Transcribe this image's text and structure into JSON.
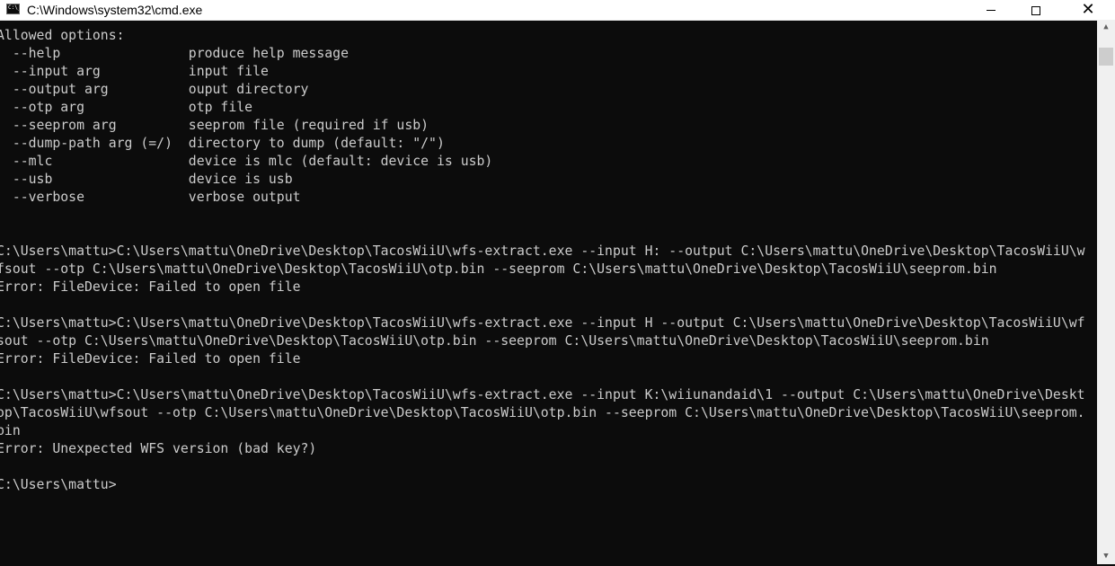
{
  "window": {
    "title": "C:\\Windows\\system32\\cmd.exe",
    "icon_text": "C:\\_",
    "controls": {
      "minimize": "minimize-icon",
      "maximize": "maximize-icon",
      "close": "✕"
    }
  },
  "console": {
    "lines": [
      "Allowed options:",
      "  --help                produce help message",
      "  --input arg           input file",
      "  --output arg          ouput directory",
      "  --otp arg             otp file",
      "  --seeprom arg         seeprom file (required if usb)",
      "  --dump-path arg (=/)  directory to dump (default: \"/\")",
      "  --mlc                 device is mlc (default: device is usb)",
      "  --usb                 device is usb",
      "  --verbose             verbose output",
      "",
      "",
      "C:\\Users\\mattu>C:\\Users\\mattu\\OneDrive\\Desktop\\TacosWiiU\\wfs-extract.exe --input H: --output C:\\Users\\mattu\\OneDrive\\Desktop\\TacosWiiU\\w",
      "fsout --otp C:\\Users\\mattu\\OneDrive\\Desktop\\TacosWiiU\\otp.bin --seeprom C:\\Users\\mattu\\OneDrive\\Desktop\\TacosWiiU\\seeprom.bin",
      "Error: FileDevice: Failed to open file",
      "",
      "C:\\Users\\mattu>C:\\Users\\mattu\\OneDrive\\Desktop\\TacosWiiU\\wfs-extract.exe --input H --output C:\\Users\\mattu\\OneDrive\\Desktop\\TacosWiiU\\wf",
      "sout --otp C:\\Users\\mattu\\OneDrive\\Desktop\\TacosWiiU\\otp.bin --seeprom C:\\Users\\mattu\\OneDrive\\Desktop\\TacosWiiU\\seeprom.bin",
      "Error: FileDevice: Failed to open file",
      "",
      "C:\\Users\\mattu>C:\\Users\\mattu\\OneDrive\\Desktop\\TacosWiiU\\wfs-extract.exe --input K:\\wiiunandaid\\1 --output C:\\Users\\mattu\\OneDrive\\Deskt",
      "op\\TacosWiiU\\wfsout --otp C:\\Users\\mattu\\OneDrive\\Desktop\\TacosWiiU\\otp.bin --seeprom C:\\Users\\mattu\\OneDrive\\Desktop\\TacosWiiU\\seeprom.",
      "bin",
      "Error: Unexpected WFS version (bad key?)",
      "",
      "C:\\Users\\mattu>"
    ]
  },
  "scrollbar": {
    "up_arrow": "▲",
    "down_arrow": "▼"
  },
  "colors": {
    "console_bg": "#0c0c0c",
    "console_fg": "#cccccc",
    "titlebar_bg": "#ffffff"
  }
}
